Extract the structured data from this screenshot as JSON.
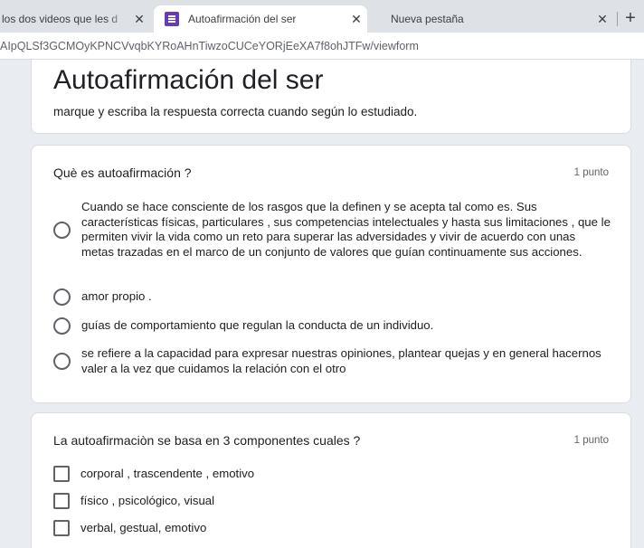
{
  "browser": {
    "tabs": [
      {
        "title": "los dos videos que les d"
      },
      {
        "title": "Autoafirmación del ser"
      },
      {
        "title": "Nueva pestaña"
      }
    ],
    "url": "AIpQLSf3GCMOyKPNCVvqbKYRoAHnTiwzoCUCeYORjEeXA7f8ohJTFw/viewform"
  },
  "form": {
    "title": "Autoafirmación del ser",
    "description": "marque y escriba la respuesta correcta cuando según lo estudiado."
  },
  "questions": [
    {
      "title": "Què es autoafirmación ?",
      "points": "1 punto",
      "options": [
        "Cuando se hace consciente de los rasgos que la definen y se acepta tal como es. Sus características físicas, particulares , sus competencias intelectuales y hasta sus limitaciones , que le permiten vivir la vida como un reto para superar las adversidades y vivir de acuerdo con unas metas trazadas en el marco de un conjunto de valores que guían continuamente sus acciones.",
        "amor propio .",
        "guías de comportamiento que regulan la conducta de un individuo.",
        "se refiere a la capacidad para expresar nuestras opiniones, plantear quejas y en general hacernos valer a la vez que cuidamos la relación con el otro"
      ]
    },
    {
      "title": "La autoafirmaciòn se basa en 3 componentes cuales ?",
      "points": "1 punto",
      "options": [
        "corporal , trascendente , emotivo",
        "físico , psicológico, visual",
        "verbal, gestual, emotivo"
      ]
    }
  ]
}
